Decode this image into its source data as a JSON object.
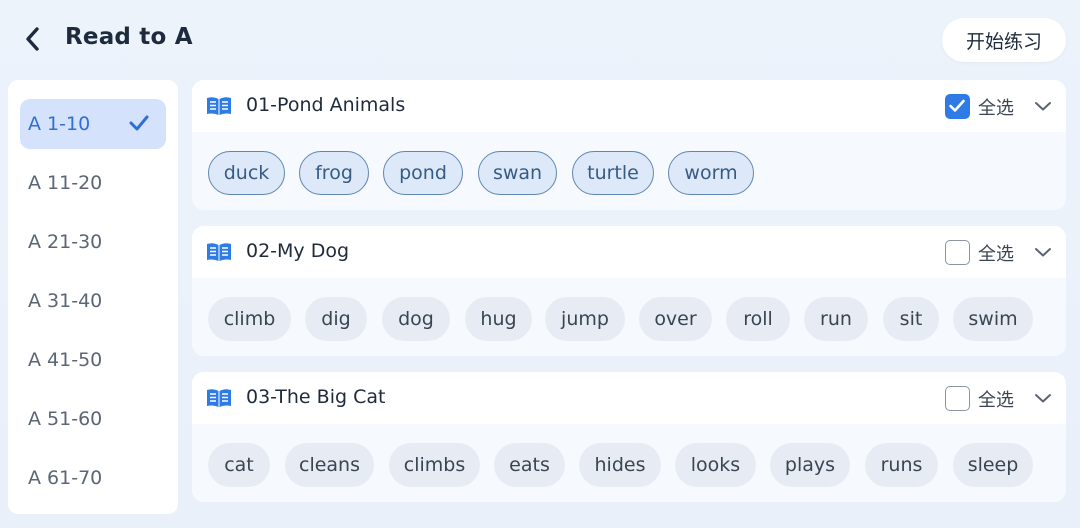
{
  "header": {
    "title": "Read to A",
    "start_label": "开始练习"
  },
  "sidebar": {
    "items": [
      {
        "label": "A 1-10",
        "active": true
      },
      {
        "label": "A 11-20"
      },
      {
        "label": "A 21-30"
      },
      {
        "label": "A 31-40"
      },
      {
        "label": "A 41-50"
      },
      {
        "label": "A 51-60"
      },
      {
        "label": "A 61-70"
      }
    ]
  },
  "cards": [
    {
      "title": "01-Pond Animals",
      "select_all_label": "全选",
      "checked": true,
      "words": [
        "duck",
        "frog",
        "pond",
        "swan",
        "turtle",
        "worm"
      ]
    },
    {
      "title": "02-My Dog",
      "select_all_label": "全选",
      "checked": false,
      "words": [
        "climb",
        "dig",
        "dog",
        "hug",
        "jump",
        "over",
        "roll",
        "run",
        "sit",
        "swim"
      ]
    },
    {
      "title": "03-The Big Cat",
      "select_all_label": "全选",
      "checked": false,
      "words": [
        "cat",
        "cleans",
        "climbs",
        "eats",
        "hides",
        "looks",
        "plays",
        "runs",
        "sleep"
      ]
    }
  ],
  "colors": {
    "accent": "#2f7be6",
    "active_bg": "#d4e3fb",
    "selected_chip_border": "#5f86b3"
  },
  "icons": {
    "back": "chevron-left-icon",
    "book": "book-icon",
    "check": "check-icon",
    "expand": "chevron-down-icon"
  }
}
